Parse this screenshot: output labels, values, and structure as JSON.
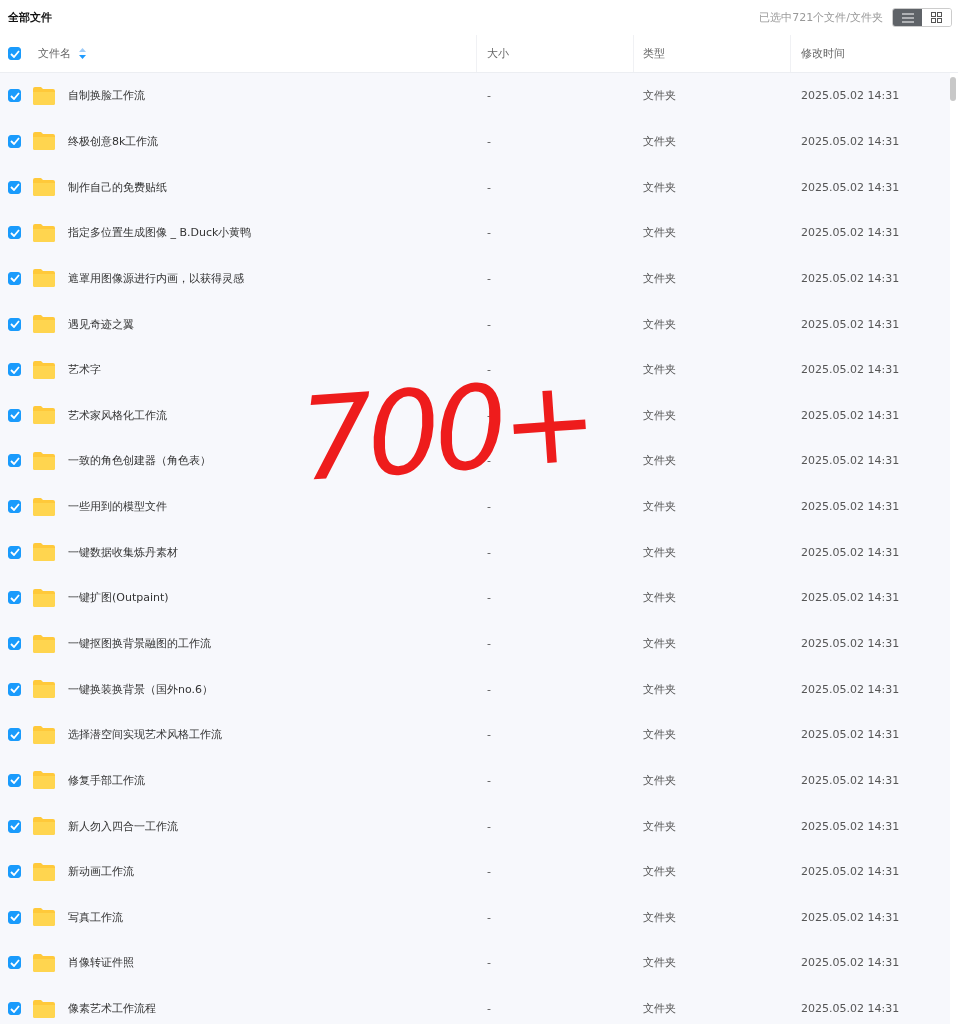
{
  "title": "全部文件",
  "selection_info": "已选中721个文件/文件夹",
  "view_toggle": [
    {
      "kind": "list",
      "selected": true
    },
    {
      "kind": "grid",
      "selected": false
    }
  ],
  "table": {
    "all_checked": true,
    "columns": [
      {
        "label": "文件名",
        "sortable": true
      },
      {
        "label": "大小",
        "sortable": false
      },
      {
        "label": "类型",
        "sortable": false
      },
      {
        "label": "修改时间",
        "sortable": false
      }
    ],
    "rows": [
      {
        "name": "自制换脸工作流",
        "size": "-",
        "type": "文件夹",
        "modified": "2025.05.02 14:31",
        "checked": true
      },
      {
        "name": "终极创意8k工作流",
        "size": "-",
        "type": "文件夹",
        "modified": "2025.05.02 14:31",
        "checked": true
      },
      {
        "name": "制作自己的免费贴纸",
        "size": "-",
        "type": "文件夹",
        "modified": "2025.05.02 14:31",
        "checked": true
      },
      {
        "name": "指定多位置生成图像 _ B.Duck小黄鸭",
        "size": "-",
        "type": "文件夹",
        "modified": "2025.05.02 14:31",
        "checked": true
      },
      {
        "name": "遮罩用图像源进行内画，以获得灵感",
        "size": "-",
        "type": "文件夹",
        "modified": "2025.05.02 14:31",
        "checked": true
      },
      {
        "name": "遇见奇迹之翼",
        "size": "-",
        "type": "文件夹",
        "modified": "2025.05.02 14:31",
        "checked": true
      },
      {
        "name": "艺术字",
        "size": "-",
        "type": "文件夹",
        "modified": "2025.05.02 14:31",
        "checked": true
      },
      {
        "name": "艺术家风格化工作流",
        "size": "-",
        "type": "文件夹",
        "modified": "2025.05.02 14:31",
        "checked": true
      },
      {
        "name": "一致的角色创建器（角色表）",
        "size": "-",
        "type": "文件夹",
        "modified": "2025.05.02 14:31",
        "checked": true
      },
      {
        "name": "一些用到的模型文件",
        "size": "-",
        "type": "文件夹",
        "modified": "2025.05.02 14:31",
        "checked": true
      },
      {
        "name": "一键数据收集炼丹素材",
        "size": "-",
        "type": "文件夹",
        "modified": "2025.05.02 14:31",
        "checked": true
      },
      {
        "name": "一键扩图(Outpaint)",
        "size": "-",
        "type": "文件夹",
        "modified": "2025.05.02 14:31",
        "checked": true
      },
      {
        "name": "一键抠图换背景融图的工作流",
        "size": "-",
        "type": "文件夹",
        "modified": "2025.05.02 14:31",
        "checked": true
      },
      {
        "name": "一键换装换背景（国外no.6）",
        "size": "-",
        "type": "文件夹",
        "modified": "2025.05.02 14:31",
        "checked": true
      },
      {
        "name": "选择潜空间实现艺术风格工作流",
        "size": "-",
        "type": "文件夹",
        "modified": "2025.05.02 14:31",
        "checked": true
      },
      {
        "name": "修复手部工作流",
        "size": "-",
        "type": "文件夹",
        "modified": "2025.05.02 14:31",
        "checked": true
      },
      {
        "name": "新人勿入四合一工作流",
        "size": "-",
        "type": "文件夹",
        "modified": "2025.05.02 14:31",
        "checked": true
      },
      {
        "name": "新动画工作流",
        "size": "-",
        "type": "文件夹",
        "modified": "2025.05.02 14:31",
        "checked": true
      },
      {
        "name": "写真工作流",
        "size": "-",
        "type": "文件夹",
        "modified": "2025.05.02 14:31",
        "checked": true
      },
      {
        "name": "肖像转证件照",
        "size": "-",
        "type": "文件夹",
        "modified": "2025.05.02 14:31",
        "checked": true
      },
      {
        "name": "像素艺术工作流程",
        "size": "-",
        "type": "文件夹",
        "modified": "2025.05.02 14:31",
        "checked": true
      }
    ]
  },
  "annotation": "700+"
}
